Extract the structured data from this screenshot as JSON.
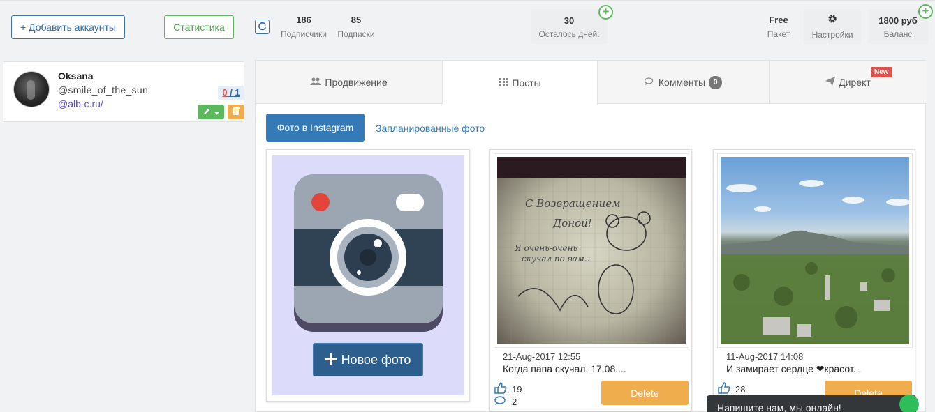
{
  "toolbar": {
    "add_accounts": "+ Добавить аккаунты",
    "statistics": "Статистика",
    "refresh_icon": "refresh-icon",
    "followers_count": "186",
    "followers_label": "Подписчики",
    "follows_count": "85",
    "follows_label": "Подписки",
    "days_count": "30",
    "days_label": "Осталось дней:",
    "package_value": "Free",
    "package_label": "Пакет",
    "settings_label": "Настройки",
    "balance_value": "1800 руб",
    "balance_label": "Баланс",
    "plus_symbol": "+"
  },
  "account": {
    "name": "Oksana",
    "handle": "@smile_of_the_sun",
    "link": "@alb-c.ru/",
    "count_used": "0",
    "count_sep": " / ",
    "count_total": "1"
  },
  "tabs": [
    {
      "label": "Продвижение",
      "icon": "users-icon"
    },
    {
      "label": "Посты",
      "icon": "grid-icon"
    },
    {
      "label": "Комменты",
      "icon": "comments-icon",
      "badge": "0"
    },
    {
      "label": "Директ",
      "icon": "send-icon",
      "badge": "New"
    }
  ],
  "subtabs": {
    "instagram_photos": "Фото в Instagram",
    "scheduled_photos": "Запланированные фото"
  },
  "new_photo": {
    "button": "Новое фото"
  },
  "posts": [
    {
      "date": "21-Aug-2017 12:55",
      "caption": "Когда папа скучал. 17.08....",
      "likes": "19",
      "comments": "2",
      "delete": "Delete"
    },
    {
      "date": "11-Aug-2017 14:08",
      "caption": "И замирает сердце ❤красот...",
      "likes": "28",
      "comments": "",
      "delete": "Delete"
    }
  ],
  "chat": {
    "text": "Напишите нам, мы онлайн!"
  },
  "colors": {
    "primary": "#337ab7",
    "success": "#5cb85c",
    "warning": "#f0ad4e",
    "danger": "#d9534f"
  }
}
